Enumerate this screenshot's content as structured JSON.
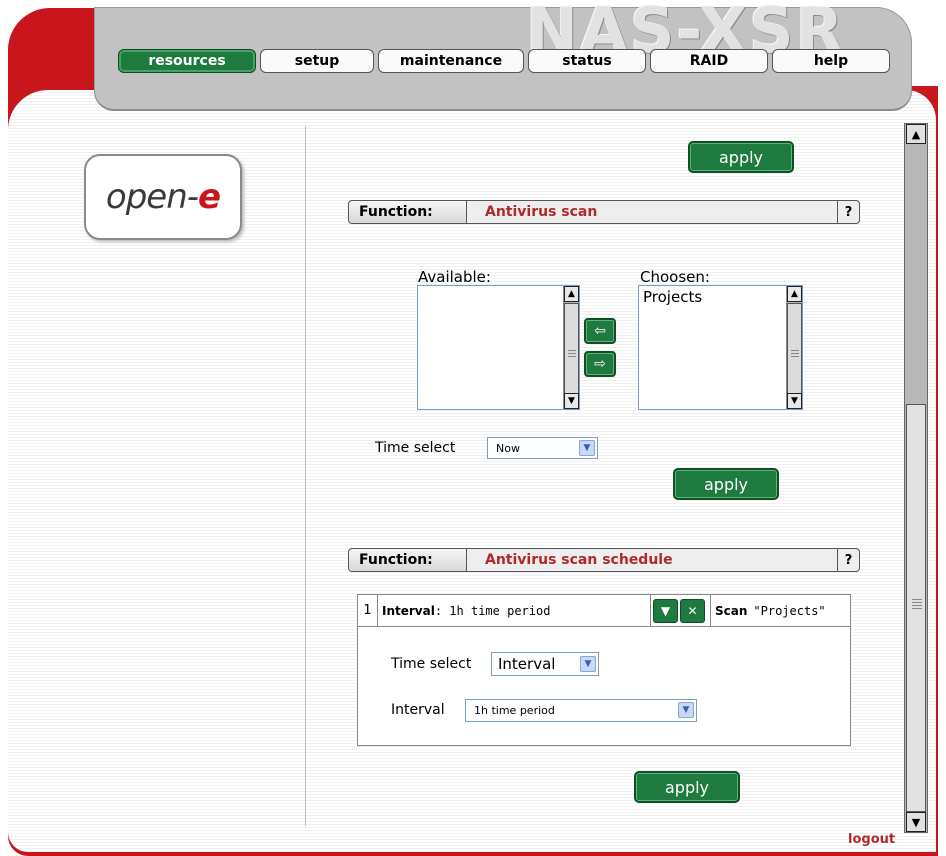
{
  "brand": "NAS-XSR",
  "nav": {
    "tabs": [
      {
        "label": "resources",
        "active": true
      },
      {
        "label": "setup"
      },
      {
        "label": "maintenance"
      },
      {
        "label": "status"
      },
      {
        "label": "RAID"
      },
      {
        "label": "help"
      }
    ]
  },
  "logo": {
    "text_main": "open-",
    "text_accent": "e"
  },
  "top_apply_label": "apply",
  "antivirus": {
    "function_label": "Function:",
    "function_name": "Antivirus scan",
    "help": "?",
    "available_label": "Available:",
    "available_items": [],
    "chosen_label": "Choosen:",
    "chosen_items": [
      "Projects"
    ],
    "time_select_label": "Time select",
    "time_select_value": "Now",
    "apply_label": "apply"
  },
  "schedule": {
    "function_label": "Function:",
    "function_name": "Antivirus scan schedule",
    "help": "?",
    "row": {
      "number": "1",
      "interval_label": "Interval",
      "interval_value": ": 1h time period",
      "scan_label": "Scan",
      "scan_value": "\"Projects\""
    },
    "time_select_label": "Time select",
    "time_select_value": "Interval",
    "interval_label": "Interval",
    "interval_value": "1h time period",
    "apply_label": "apply"
  },
  "logout_label": "logout",
  "colors": {
    "brand_red": "#c8161c",
    "button_green": "#1e7a3e",
    "function_red": "#b02a2a"
  }
}
